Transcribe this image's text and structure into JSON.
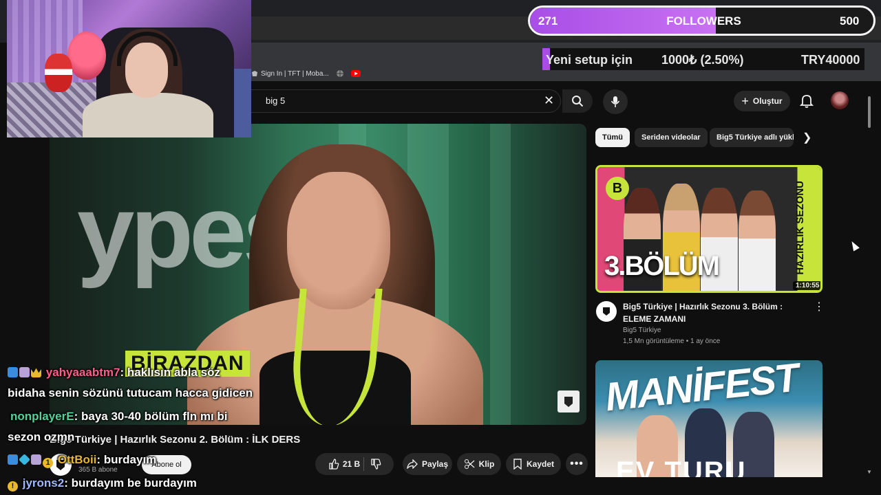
{
  "browser": {
    "bookmarks": [
      {
        "label": "Sign In | TFT | Moba...",
        "icon": "riot-fist-icon"
      },
      {
        "label": "",
        "icon": "globe-icon"
      },
      {
        "label": "",
        "icon": "youtube-icon"
      }
    ]
  },
  "youtube": {
    "search_value": "big 5",
    "create_label": "Oluştur"
  },
  "player": {
    "watermark": "ypes",
    "overlay_caption": "BİRAZDAN"
  },
  "video": {
    "title": "Big5 Türkiye | Hazırlık Sezonu 2. Bölüm : İLK DERS",
    "channel": "Big5 Türkiye",
    "subscribers": "365 B abone",
    "subscribe_label": "Abone ol",
    "likes": "21 B",
    "share_label": "Paylaş",
    "clip_label": "Klip",
    "save_label": "Kaydet"
  },
  "chips": [
    "Tümü",
    "Seriden videolar",
    "Big5 Türkiye adlı yükleyiciden"
  ],
  "recommendations": [
    {
      "thumb_text": "3.BÖLÜM",
      "thumb_side_text": "HAZIRLIK SEZONU",
      "duration": "1:10:55",
      "title": "Big5 Türkiye | Hazırlık Sezonu 3. Bölüm : ELEME ZAMANI",
      "channel": "Big5 Türkiye",
      "meta": "1,5 Mn görüntüleme • 1 ay önce"
    },
    {
      "thumb_text": "MANİFEST",
      "thumb_sub_text": "EV TURU VLOG"
    }
  ],
  "overlays": {
    "followers_goal": {
      "current": "271",
      "label": "FOLLOWERS",
      "target": "500",
      "progress": 0.542
    },
    "donation_goal": {
      "label": "Yeni setup için",
      "amount": "1000₺ (2.50%)",
      "target": "TRY40000",
      "progress": 0.025
    }
  },
  "chat": [
    {
      "user": "yahyaaabtm7",
      "user_color": "#ff5f8a",
      "text": ": haklısın abla söz",
      "cont": "bidaha senin sözünü tutucam hacca gidicen"
    },
    {
      "user": "nonplayerE",
      "user_color": "#4fd49a",
      "text": ": baya 30-40 bölüm fln mı bi",
      "cont": "sezon ozmn"
    },
    {
      "user": "OttBoii",
      "user_color": "#e8b82d",
      "text": ": burdayım"
    },
    {
      "user": "jyrons2",
      "user_color": "#9fb8ff",
      "text": ": burdayım be burdayım"
    }
  ],
  "colors": {
    "accent_green": "#c6e43a",
    "goal_purple": "#a84ee6",
    "yt_bg": "#0f0f0f"
  }
}
